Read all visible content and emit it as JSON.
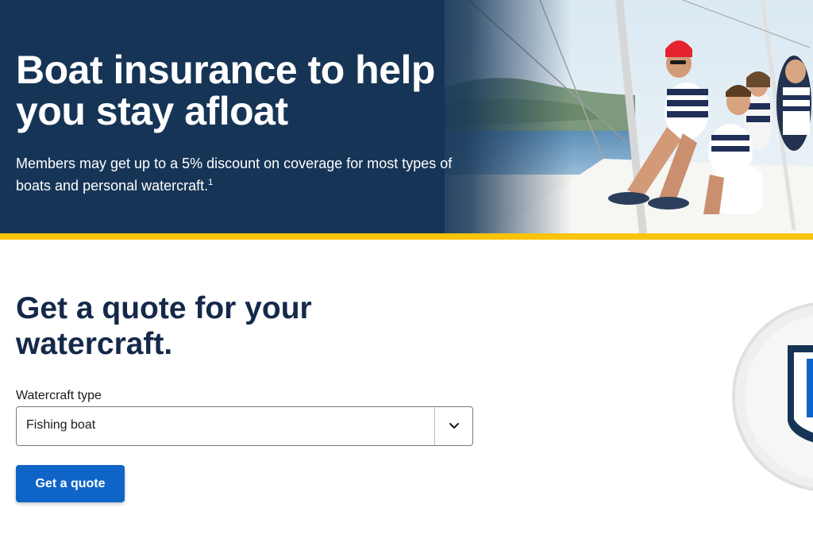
{
  "hero": {
    "title": "Boat insurance to help you stay afloat",
    "subtitle": "Members may get up to a 5% discount on coverage for most types of boats and personal watercraft.",
    "footnote": "1"
  },
  "quote_form": {
    "heading": "Get a quote for your watercraft.",
    "field_label": "Watercraft type",
    "selected_value": "Fishing boat",
    "button_label": "Get a quote"
  },
  "colors": {
    "hero_bg": "#163556",
    "accent_bar": "#fcc30b",
    "heading": "#14294a",
    "button": "#0f64c8"
  },
  "icons": {
    "select_chevron": "chevron-down-icon",
    "decorative_badge": "shield-badge-icon"
  }
}
